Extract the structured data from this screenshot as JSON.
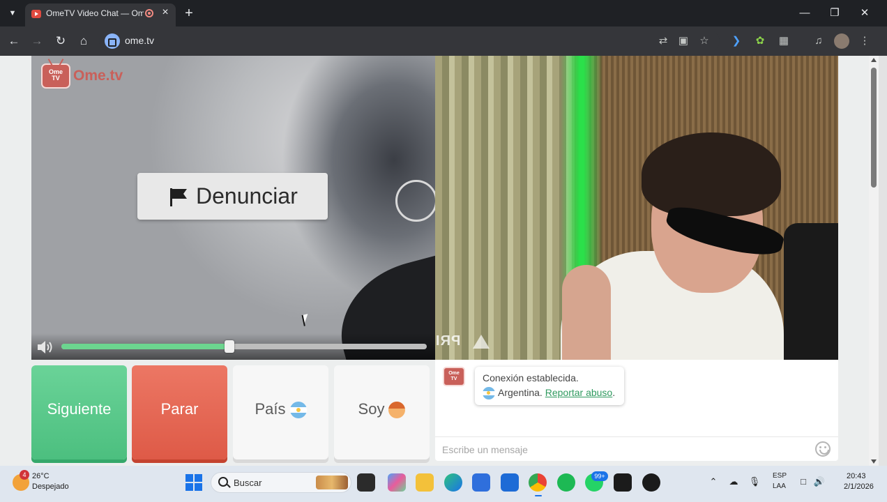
{
  "browser": {
    "tab_title": "OmeTV Video Chat — Ome",
    "url": "ome.tv",
    "accent_color": "#8ab4f8"
  },
  "app": {
    "logo_text": "Ome.tv",
    "logo_small": "Ome TV",
    "report_button": "Denunciar",
    "volume_level": 0.46,
    "watermark": "PRI",
    "buttons": {
      "next": "Siguiente",
      "stop": "Parar",
      "country": "País",
      "gender": "Soy"
    },
    "colors": {
      "next": "#4cbf7f",
      "stop": "#de5a47",
      "brand": "#c9605a"
    },
    "chat": {
      "line1": "Conexión establecida.",
      "country": "Argentina.",
      "report_link": "Reportar abuso",
      "period": ".",
      "input_placeholder": "Escribe un mensaje"
    }
  },
  "taskbar": {
    "weather_badge": "4",
    "temperature": "26°C",
    "weather": "Despejado",
    "search_placeholder": "Buscar",
    "whatsapp_badge": "99+",
    "lang_line1": "ESP",
    "lang_line2": "LAA",
    "time": "20:43",
    "date": "2/1/2026"
  }
}
